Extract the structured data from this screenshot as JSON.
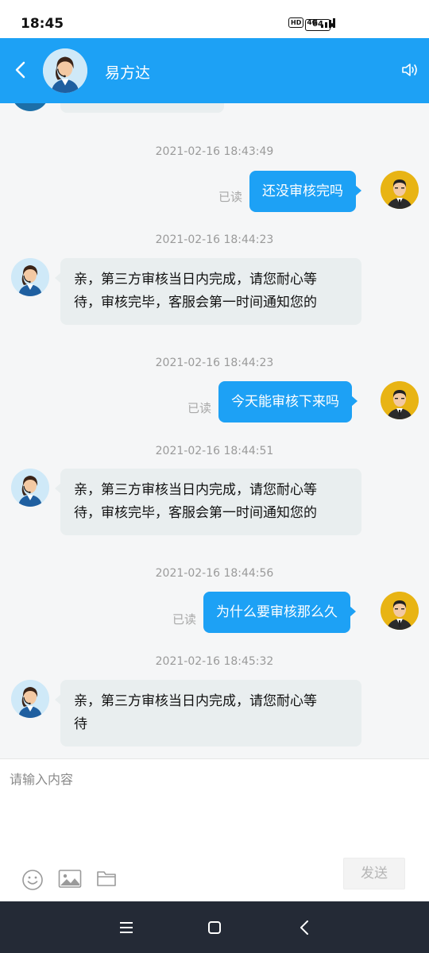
{
  "status": {
    "time": "18:45",
    "hd": "HD",
    "network": "4G",
    "battery": "64"
  },
  "header": {
    "title": "易方达",
    "back_icon": "chevron-left-icon",
    "speaker_icon": "speaker-icon"
  },
  "messages": [
    {
      "type": "timestamp",
      "text": "2021-02-16 18:43:49"
    },
    {
      "type": "outgoing",
      "text": "还没审核完吗",
      "read": "已读"
    },
    {
      "type": "timestamp",
      "text": "2021-02-16 18:44:23"
    },
    {
      "type": "incoming",
      "lines": [
        "亲，第三方审核当日内完成，请您耐心等",
        "待，审核完毕，客服会第一时间通知您的"
      ]
    },
    {
      "type": "timestamp",
      "text": "2021-02-16 18:44:23"
    },
    {
      "type": "outgoing",
      "text": "今天能审核下来吗",
      "read": "已读"
    },
    {
      "type": "timestamp",
      "text": "2021-02-16 18:44:51"
    },
    {
      "type": "incoming",
      "lines": [
        "亲，第三方审核当日内完成，请您耐心等",
        "待，审核完毕，客服会第一时间通知您的"
      ]
    },
    {
      "type": "timestamp",
      "text": "2021-02-16 18:44:56"
    },
    {
      "type": "outgoing",
      "text": "为什么要审核那么久",
      "read": "已读"
    },
    {
      "type": "timestamp",
      "text": "2021-02-16 18:45:32"
    },
    {
      "type": "incoming",
      "lines": [
        "亲，第三方审核当日内完成，请您耐心等",
        "待"
      ]
    }
  ],
  "composer": {
    "placeholder": "请输入内容",
    "send_label": "发送",
    "tools": [
      "emoji-icon",
      "image-icon",
      "folder-icon"
    ]
  },
  "nav": [
    "menu-icon",
    "home-icon",
    "back-icon"
  ],
  "colors": {
    "accent": "#1da1f5",
    "incoming_bubble": "#e9eeef",
    "nav_bar": "#242a36"
  }
}
